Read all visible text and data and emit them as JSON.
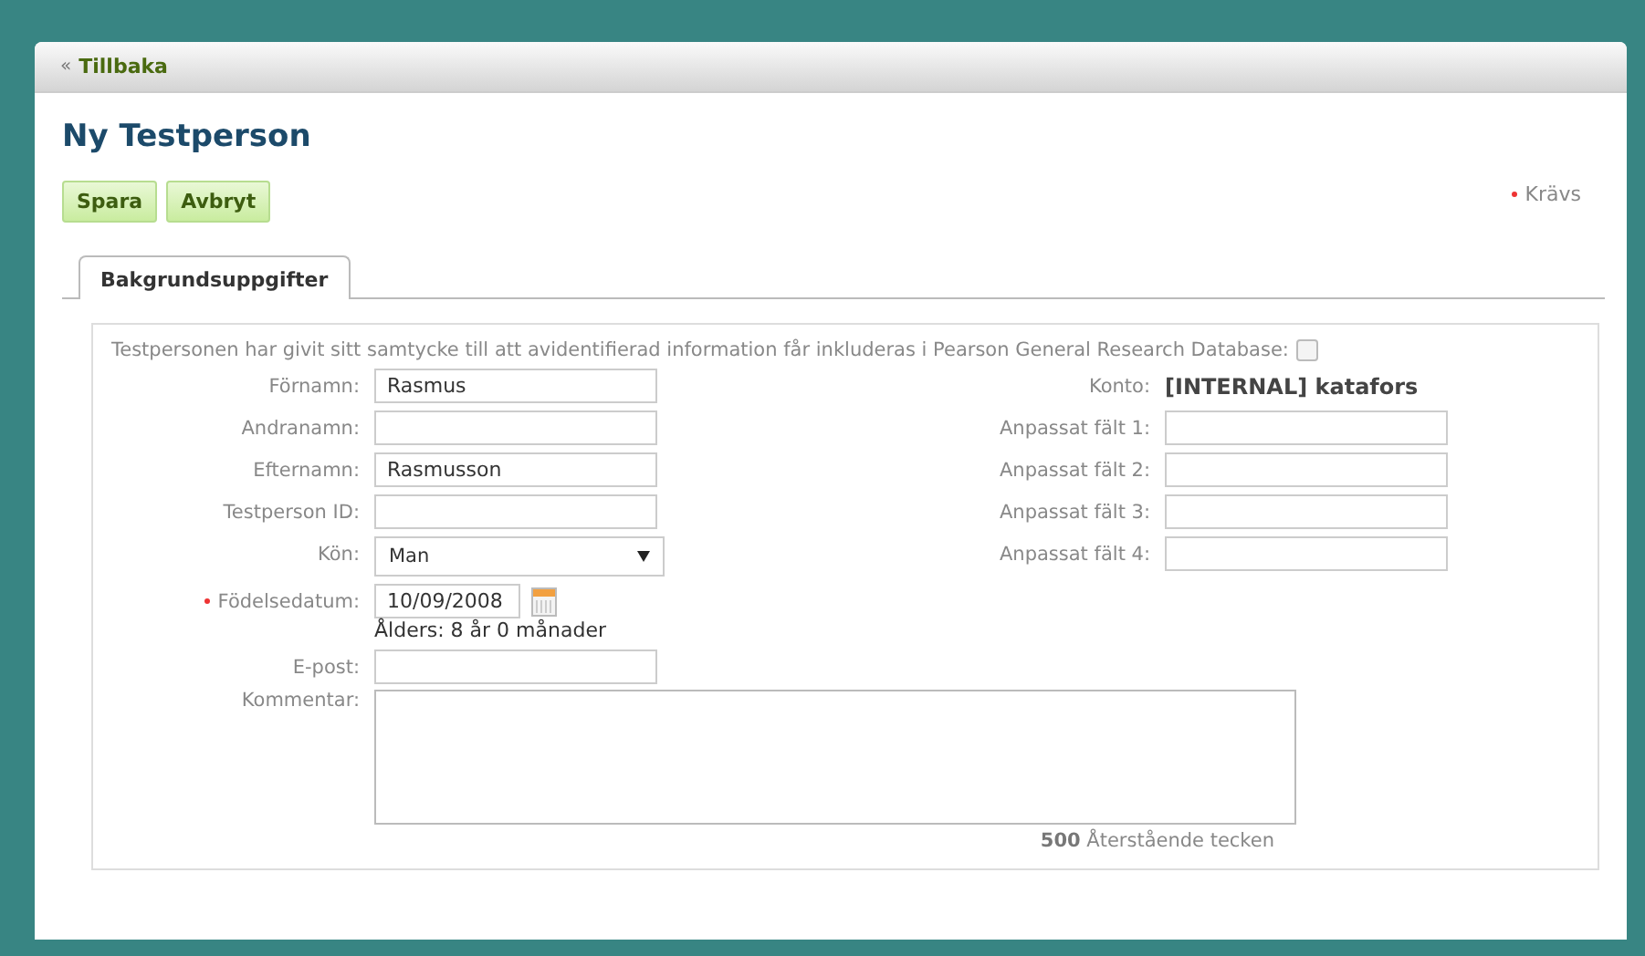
{
  "back_link": {
    "icon": "«",
    "label": "Tillbaka"
  },
  "title": "Ny Testperson",
  "buttons": [
    "Spara",
    "Avbryt"
  ],
  "required_note": "Krävs",
  "tabs": [
    {
      "label": "Bakgrundsuppgifter",
      "selected": true
    }
  ],
  "consent": {
    "text": "Testpersonen har givit sitt samtycke till att avidentifierad information får inkluderas i Pearson General Research Database:",
    "checked": false
  },
  "left_fields": [
    {
      "kind": "text",
      "label": "Förnamn:",
      "value": "Rasmus",
      "required": false
    },
    {
      "kind": "text",
      "label": "Andranamn:",
      "required": false
    },
    {
      "kind": "text",
      "label": "Efternamn:",
      "value": "Rasmusson",
      "required": false
    },
    {
      "kind": "text",
      "label": "Testperson ID:",
      "required": false
    },
    {
      "kind": "select",
      "label": "Kön:",
      "value": "Man",
      "required": false
    },
    {
      "kind": "date",
      "label": "Födelsedatum:",
      "value": "10/09/2008",
      "note": "Ålders: 8 år 0 månader",
      "required": true
    },
    {
      "kind": "text",
      "label": "E-post:",
      "required": false
    }
  ],
  "right_fields": [
    {
      "kind": "static",
      "label": "Konto:",
      "value": "[INTERNAL] katafors"
    },
    {
      "kind": "text",
      "label": "Anpassat fält 1:"
    },
    {
      "kind": "text",
      "label": "Anpassat fält 2:"
    },
    {
      "kind": "text",
      "label": "Anpassat fält 3:"
    },
    {
      "kind": "text",
      "label": "Anpassat fält 4:"
    }
  ],
  "comment": {
    "label": "Kommentar:",
    "counter": "**500** Återstående tecken"
  }
}
